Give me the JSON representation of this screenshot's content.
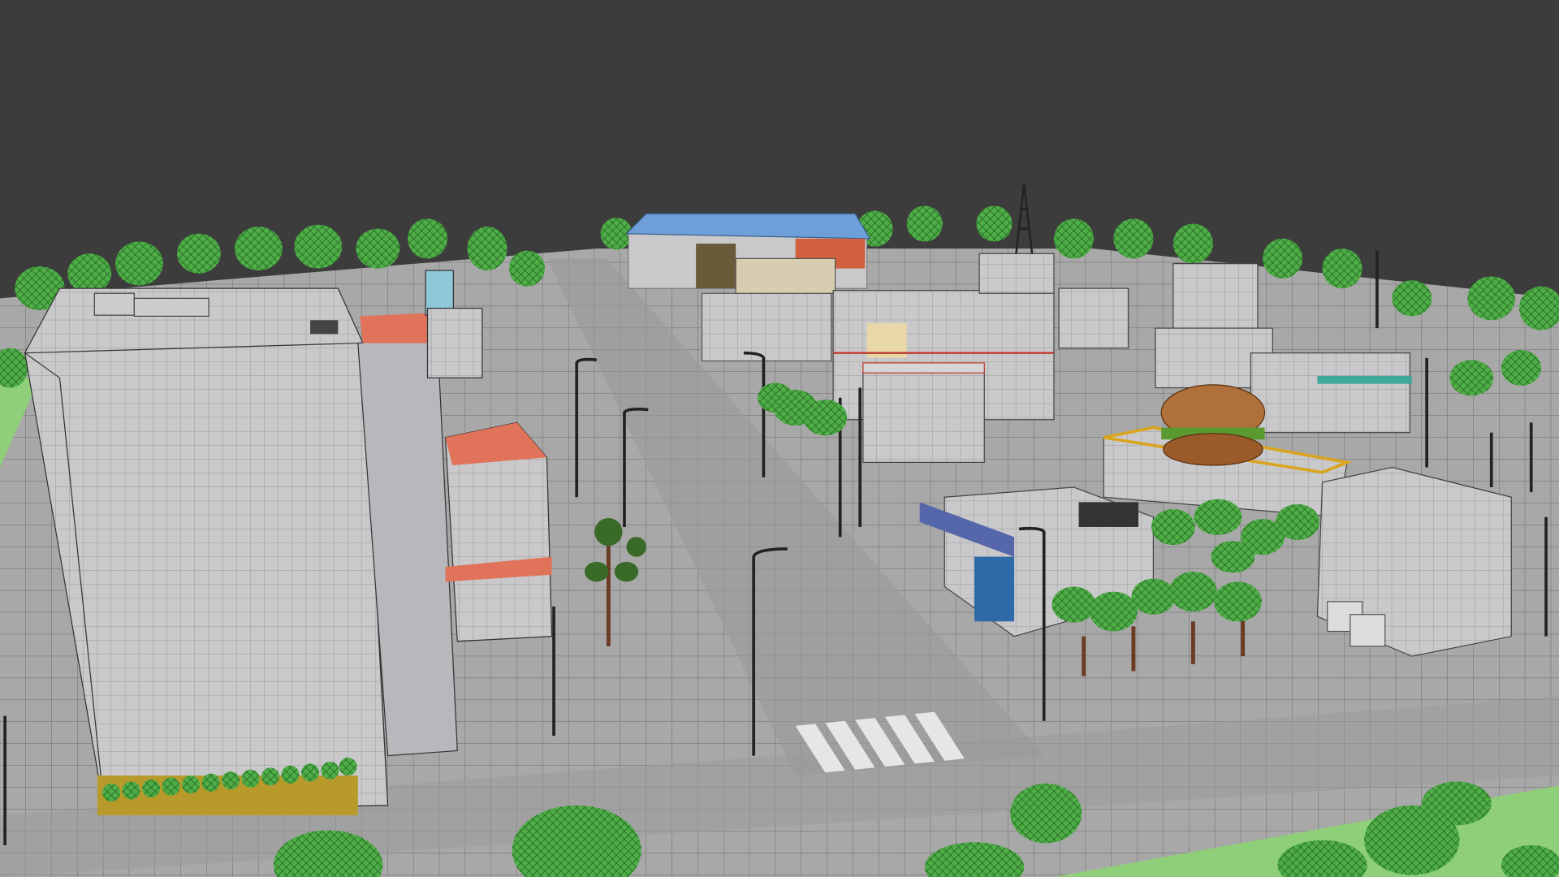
{
  "scene": {
    "type": "3d-viewport-render",
    "colors": {
      "background": "#3c3c3c",
      "ground": "#a8a8a8",
      "grid": "#5a5a5a",
      "grass": "#8fcf7a",
      "foliage": "#4fae47",
      "foliage_dark": "#2f7d2c",
      "building": "#c9c9cb",
      "building_shadow": "#9c9ca0",
      "roof_accent": "#e0735a",
      "roof_blue": "#6f9fd8",
      "trunk": "#6b3b24",
      "burger": "#b0703a",
      "pole": "#2a2a2a"
    }
  }
}
